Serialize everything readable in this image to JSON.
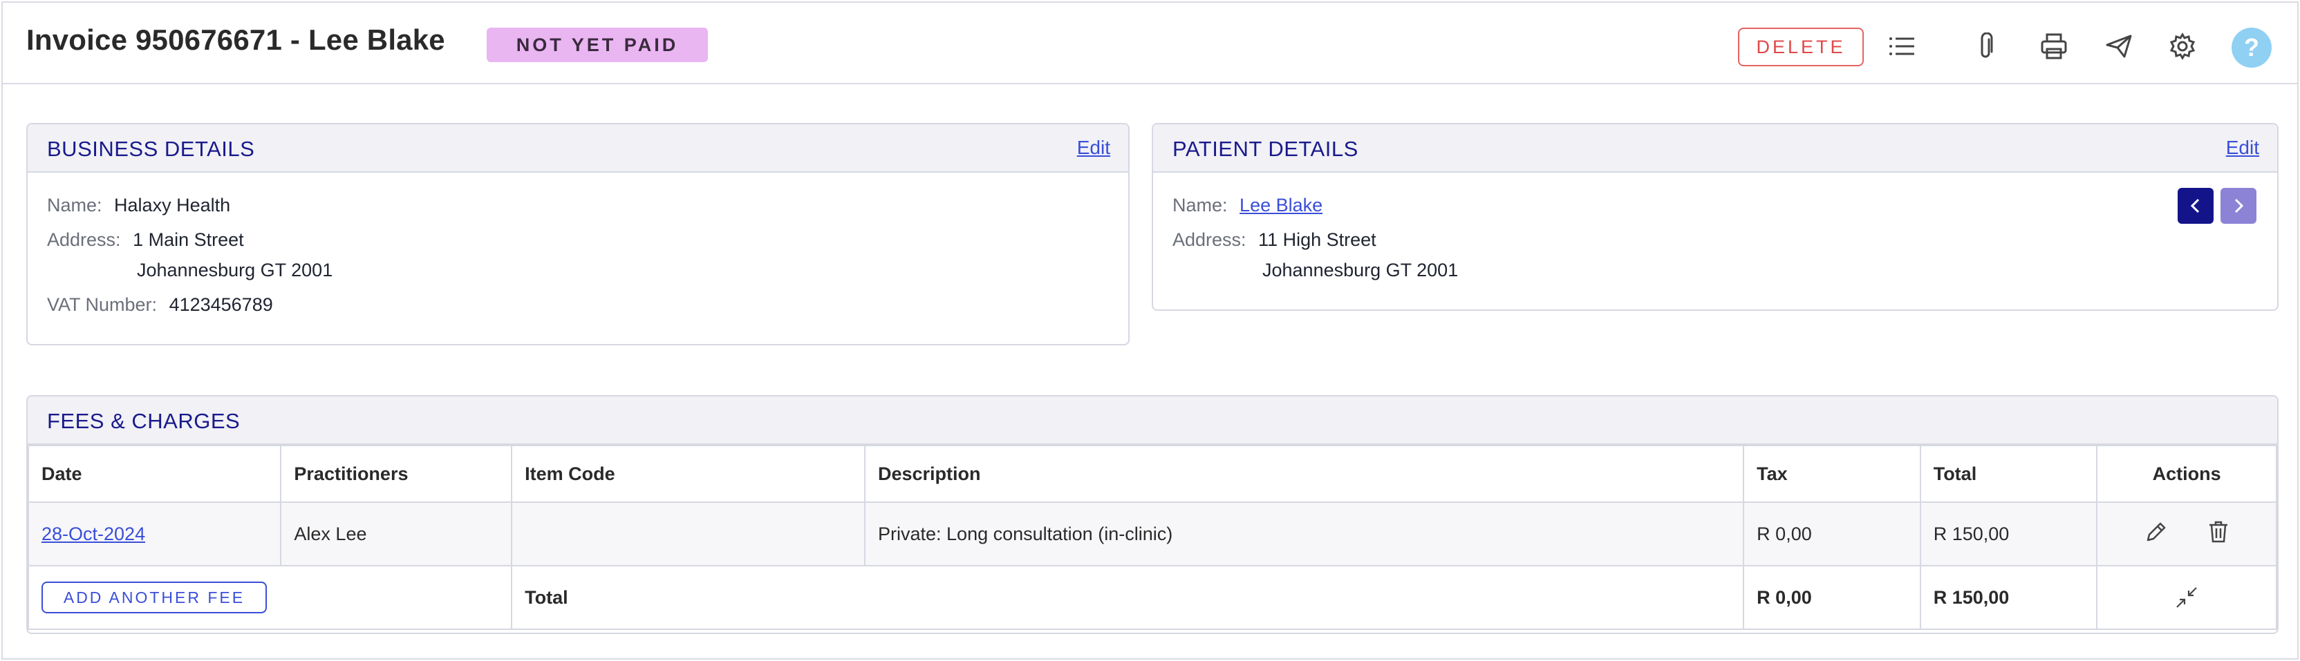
{
  "header": {
    "title": "Invoice 950676671 - Lee Blake",
    "status": "NOT YET PAID",
    "delete_label": "DELETE",
    "help_label": "?"
  },
  "business": {
    "title": "BUSINESS DETAILS",
    "edit_label": "Edit",
    "name_label": "Name:",
    "name": "Halaxy Health",
    "address_label": "Address:",
    "address_line1": "1 Main Street",
    "address_line2": "Johannesburg GT 2001",
    "vat_label": "VAT Number:",
    "vat": "4123456789"
  },
  "patient": {
    "title": "PATIENT DETAILS",
    "edit_label": "Edit",
    "name_label": "Name:",
    "name": "Lee Blake",
    "address_label": "Address:",
    "address_line1": "11 High Street",
    "address_line2": "Johannesburg GT 2001"
  },
  "fees": {
    "title": "FEES & CHARGES",
    "columns": [
      "Date",
      "Practitioners",
      "Item Code",
      "Description",
      "Tax",
      "Total",
      "Actions"
    ],
    "rows": [
      {
        "date": "28-Oct-2024",
        "practitioner": "Alex Lee",
        "item_code": "",
        "description": "Private: Long consultation (in-clinic)",
        "tax": "R 0,00",
        "total": "R 150,00"
      }
    ],
    "add_label": "ADD ANOTHER FEE",
    "total_label": "Total",
    "total_tax": "R 0,00",
    "total_amount": "R 150,00"
  },
  "colors": {
    "accent": "#1a1a8c",
    "link": "#3a4ed8",
    "badge": "#e9b6f2",
    "delete": "#e04848",
    "help": "#8fd0f3"
  }
}
